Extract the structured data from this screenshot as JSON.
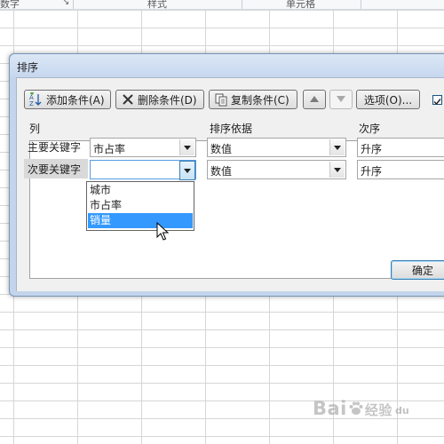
{
  "ribbon": {
    "groups": [
      "数字",
      "样式",
      "单元格"
    ],
    "corner": "↘"
  },
  "watermark": {
    "brand": "Bai",
    "brand2": "经验",
    "sub": "du"
  },
  "dialog": {
    "title": "排序",
    "toolbar": {
      "add_label": "添加条件(A)",
      "delete_label": "删除条件(D)",
      "copy_label": "复制条件(C)",
      "options_label": "选项(O)..."
    },
    "headers": {
      "column": "列",
      "sort_on": "排序依据",
      "order": "次序"
    },
    "rows": [
      {
        "label": "主要关键字",
        "column": "市占率",
        "sort_on": "数值",
        "order": "升序"
      },
      {
        "label": "次要关键字",
        "column": "",
        "sort_on": "数值",
        "order": "升序"
      }
    ],
    "dropdown_options": [
      "城市",
      "市占率",
      "销量"
    ],
    "selected_option": "销量",
    "ok_label": "确定",
    "colors": {
      "accent": "#3399ff",
      "frame": "#c3d5ec"
    }
  }
}
